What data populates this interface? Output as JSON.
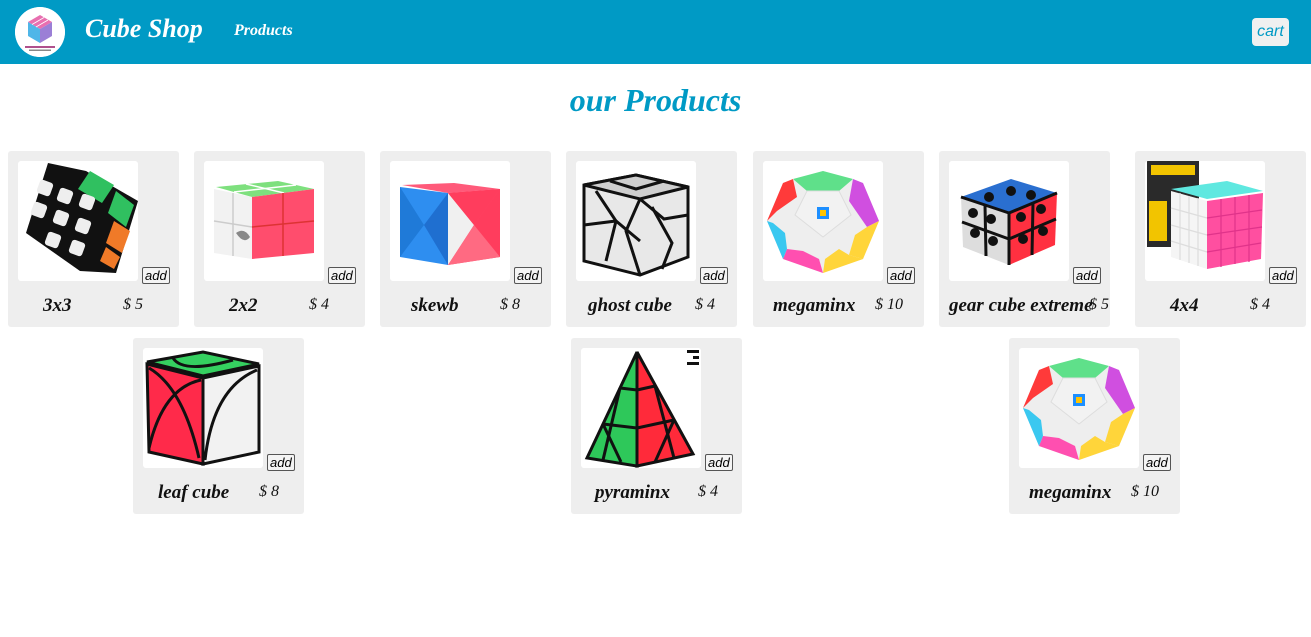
{
  "header": {
    "brand": "Cube Shop",
    "nav_products": "Products",
    "cart_label": "cart",
    "brand_color": "#009ac5"
  },
  "main": {
    "title": "our Products",
    "add_label": "add",
    "products": [
      {
        "name": "3x3",
        "price": "$ 5",
        "image": "3x3-cube-image"
      },
      {
        "name": "2x2",
        "price": "$ 4",
        "image": "2x2-cube-image"
      },
      {
        "name": "skewb",
        "price": "$ 8",
        "image": "skewb-image"
      },
      {
        "name": "ghost cube",
        "price": "$ 4",
        "image": "ghost-cube-image"
      },
      {
        "name": "megaminx",
        "price": "$ 10",
        "image": "megaminx-image"
      },
      {
        "name": "gear cube extreme",
        "price": "$ 5",
        "image": "gear-cube-image"
      },
      {
        "name": "4x4",
        "price": "$ 4",
        "image": "4x4-cube-image"
      },
      {
        "name": "leaf cube",
        "price": "$ 8",
        "image": "leaf-cube-image"
      },
      {
        "name": "pyraminx",
        "price": "$ 4",
        "image": "pyraminx-image"
      },
      {
        "name": "megaminx",
        "price": "$ 10",
        "image": "megaminx-image"
      }
    ]
  }
}
